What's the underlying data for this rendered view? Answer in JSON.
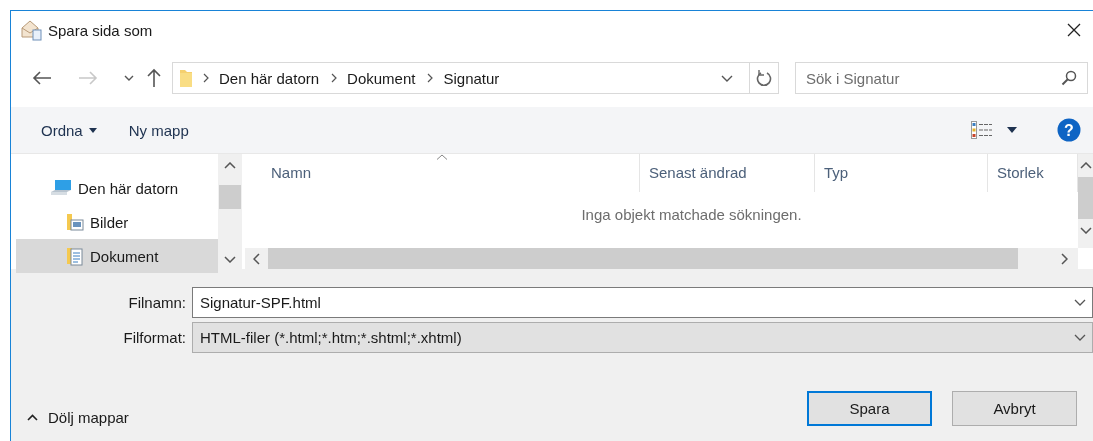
{
  "window": {
    "title": "Spara sida som"
  },
  "nav_buttons": [
    {
      "kind": "back",
      "disabled": false
    },
    {
      "kind": "forward",
      "disabled": true
    },
    {
      "kind": "recent",
      "disabled": false
    },
    {
      "kind": "up",
      "disabled": false
    }
  ],
  "breadcrumb": [
    "Den här datorn",
    "Dokument",
    "Signatur"
  ],
  "search": {
    "placeholder": "Sök i Signatur"
  },
  "toolbar": {
    "organize": "Ordna",
    "new_folder": "Ny mapp",
    "help": "?"
  },
  "sidebar": {
    "items": [
      {
        "kind": "computer",
        "label": "Den här datorn",
        "selected": false,
        "children": [
          {
            "kind": "pictures",
            "label": "Bilder",
            "selected": false
          },
          {
            "kind": "documents",
            "label": "Dokument",
            "selected": true
          }
        ]
      }
    ]
  },
  "table": {
    "columns": [
      {
        "label": "Namn",
        "sorted": true
      },
      {
        "label": "Senast ändrad",
        "sorted": false
      },
      {
        "label": "Typ",
        "sorted": false
      },
      {
        "label": "Storlek",
        "sorted": false
      }
    ],
    "empty_message": "Inga objekt matchade sökningen."
  },
  "fields": [
    {
      "kind": "editable",
      "label": "Filnamn:",
      "value": "Signatur-SPF.html"
    },
    {
      "kind": "select",
      "label": "Filformat:",
      "value": "HTML-filer (*.html;*.htm;*.shtml;*.xhtml)"
    }
  ],
  "hide_folders": "Dölj mappar",
  "buttons": [
    {
      "label": "Spara",
      "default": true
    },
    {
      "label": "Avbryt",
      "default": false
    }
  ]
}
